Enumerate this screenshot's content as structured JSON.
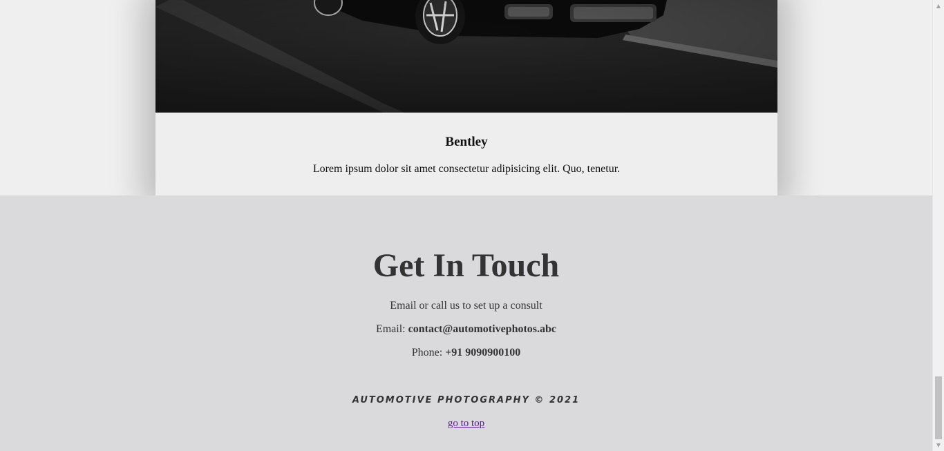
{
  "card": {
    "image_alt": "black Bentley car on asphalt road",
    "title": "Bentley",
    "description": "Lorem ipsum dolor sit amet consectetur adipisicing elit. Quo, tenetur."
  },
  "contact": {
    "heading": "Get In Touch",
    "subtitle": "Email or call us to set up a consult",
    "email_label": "Email: ",
    "email_value": "contact@automotivephotos.abc",
    "phone_label": "Phone: ",
    "phone_value": "+91 9090900100"
  },
  "footer": {
    "copyright": "Automotive Photography © 2021",
    "go_to_top": "go to top"
  },
  "scrollbar": {
    "up_icon": "triangle-up",
    "down_icon": "triangle-down"
  },
  "colors": {
    "page_bg": "#efefef",
    "contact_bg": "#dadadc",
    "text": "#333333",
    "link_visited": "#551a8b"
  }
}
